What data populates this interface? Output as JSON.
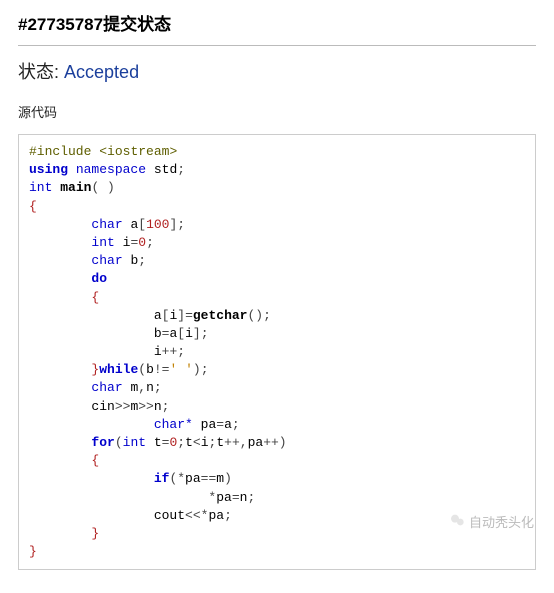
{
  "title": "#27735787提交状态",
  "status": {
    "label": "状态:",
    "value": "Accepted"
  },
  "source": {
    "label": "源代码"
  },
  "code": {
    "tokens": [
      [
        [
          "pre",
          "#include"
        ],
        [
          "op",
          " "
        ],
        [
          "pre",
          "<iostream>"
        ]
      ],
      [
        [
          "kw",
          "using"
        ],
        [
          "op",
          " "
        ],
        [
          "kw2",
          "namespace"
        ],
        [
          "op",
          " "
        ],
        [
          "id",
          "std"
        ],
        [
          "op",
          ";"
        ]
      ],
      [
        [
          "type",
          "int"
        ],
        [
          "op",
          " "
        ],
        [
          "fn",
          "main"
        ],
        [
          "op",
          "( )"
        ]
      ],
      [
        [
          "br",
          "{"
        ]
      ],
      [
        [
          "op",
          "        "
        ],
        [
          "type",
          "char"
        ],
        [
          "op",
          " "
        ],
        [
          "id",
          "a"
        ],
        [
          "op",
          "["
        ],
        [
          "num",
          "100"
        ],
        [
          "op",
          "];"
        ]
      ],
      [
        [
          "op",
          "        "
        ],
        [
          "type",
          "int"
        ],
        [
          "op",
          " "
        ],
        [
          "id",
          "i"
        ],
        [
          "op",
          "="
        ],
        [
          "num",
          "0"
        ],
        [
          "op",
          ";"
        ]
      ],
      [
        [
          "op",
          "        "
        ],
        [
          "type",
          "char"
        ],
        [
          "op",
          " "
        ],
        [
          "id",
          "b"
        ],
        [
          "op",
          ";"
        ]
      ],
      [
        [
          "op",
          "        "
        ],
        [
          "kw",
          "do"
        ]
      ],
      [
        [
          "op",
          "        "
        ],
        [
          "br",
          "{"
        ]
      ],
      [
        [
          "op",
          "                "
        ],
        [
          "id",
          "a"
        ],
        [
          "op",
          "["
        ],
        [
          "id",
          "i"
        ],
        [
          "op",
          "]="
        ],
        [
          "fn",
          "getchar"
        ],
        [
          "op",
          "();"
        ]
      ],
      [
        [
          "op",
          "                "
        ],
        [
          "id",
          "b"
        ],
        [
          "op",
          "="
        ],
        [
          "id",
          "a"
        ],
        [
          "op",
          "["
        ],
        [
          "id",
          "i"
        ],
        [
          "op",
          "];"
        ]
      ],
      [
        [
          "op",
          "                "
        ],
        [
          "id",
          "i"
        ],
        [
          "op",
          "++;"
        ]
      ],
      [
        [
          "op",
          "        "
        ],
        [
          "br",
          "}"
        ],
        [
          "kw",
          "while"
        ],
        [
          "op",
          "("
        ],
        [
          "id",
          "b"
        ],
        [
          "op",
          "!="
        ],
        [
          "str",
          "' '"
        ],
        [
          "op",
          ");"
        ]
      ],
      [
        [
          "op",
          "        "
        ],
        [
          "type",
          "char"
        ],
        [
          "op",
          " "
        ],
        [
          "id",
          "m"
        ],
        [
          "op",
          ","
        ],
        [
          "id",
          "n"
        ],
        [
          "op",
          ";"
        ]
      ],
      [
        [
          "op",
          "        "
        ],
        [
          "id",
          "cin"
        ],
        [
          "op",
          ">>"
        ],
        [
          "id",
          "m"
        ],
        [
          "op",
          ">>"
        ],
        [
          "id",
          "n"
        ],
        [
          "op",
          ";"
        ]
      ],
      [
        [
          "op",
          "                "
        ],
        [
          "type",
          "char*"
        ],
        [
          "op",
          " "
        ],
        [
          "id",
          "pa"
        ],
        [
          "op",
          "="
        ],
        [
          "id",
          "a"
        ],
        [
          "op",
          ";"
        ]
      ],
      [
        [
          "op",
          "        "
        ],
        [
          "kw",
          "for"
        ],
        [
          "op",
          "("
        ],
        [
          "type",
          "int"
        ],
        [
          "op",
          " "
        ],
        [
          "id",
          "t"
        ],
        [
          "op",
          "="
        ],
        [
          "num",
          "0"
        ],
        [
          "op",
          ";"
        ],
        [
          "id",
          "t"
        ],
        [
          "op",
          "<"
        ],
        [
          "id",
          "i"
        ],
        [
          "op",
          ";"
        ],
        [
          "id",
          "t"
        ],
        [
          "op",
          "++,"
        ],
        [
          "id",
          "pa"
        ],
        [
          "op",
          "++)"
        ]
      ],
      [
        [
          "op",
          "        "
        ],
        [
          "br",
          "{"
        ]
      ],
      [
        [
          "op",
          "                "
        ],
        [
          "kw",
          "if"
        ],
        [
          "op",
          "(*"
        ],
        [
          "id",
          "pa"
        ],
        [
          "op",
          "=="
        ],
        [
          "id",
          "m"
        ],
        [
          "op",
          ")"
        ]
      ],
      [
        [
          "op",
          "                       *"
        ],
        [
          "id",
          "pa"
        ],
        [
          "op",
          "="
        ],
        [
          "id",
          "n"
        ],
        [
          "op",
          ";"
        ]
      ],
      [
        [
          "op",
          "                "
        ],
        [
          "id",
          "cout"
        ],
        [
          "op",
          "<<*"
        ],
        [
          "id",
          "pa"
        ],
        [
          "op",
          ";"
        ]
      ],
      [
        [
          "op",
          "        "
        ],
        [
          "br",
          "}"
        ]
      ],
      [
        [
          "br",
          "}"
        ]
      ]
    ]
  },
  "watermark": "自动秃头化"
}
